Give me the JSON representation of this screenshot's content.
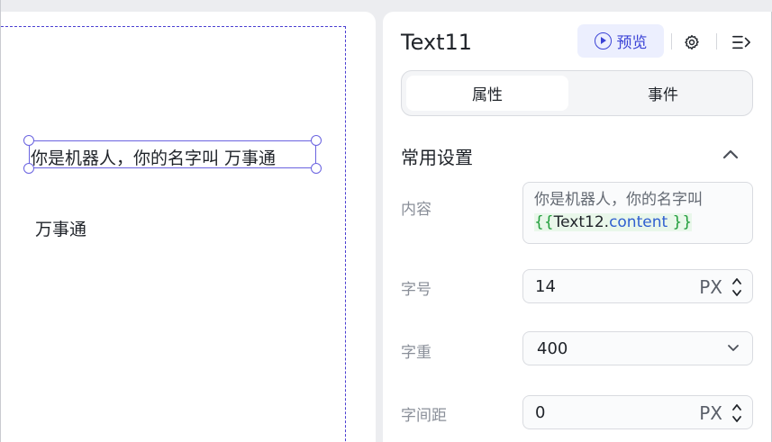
{
  "canvas": {
    "selected_text": "你是机器人，你的名字叫 万事通",
    "text12": "万事通"
  },
  "panel": {
    "title": "Text11",
    "preview_label": "预览",
    "tabs": [
      "属性",
      "事件"
    ],
    "section_title": "常用设置",
    "content": {
      "label": "内容",
      "text_prefix": "你是机器人，你的名字叫 ",
      "open_brace": "{{",
      "expr_object": "Text12.",
      "expr_prop": "content",
      "close_brace": " }}"
    },
    "font_size": {
      "label": "字号",
      "value": "14",
      "unit": "PX"
    },
    "font_weight": {
      "label": "字重",
      "value": "400"
    },
    "letter_spacing": {
      "label": "字间距",
      "value": "0",
      "unit": "PX"
    }
  },
  "colors": {
    "accent": "#3b43d6",
    "selection": "#6a63e0",
    "binding_bg": "#e9f7ea",
    "binding_brace": "#1f9d3a"
  },
  "icons": [
    "play-icon",
    "gear-icon",
    "collapse-panel-icon",
    "chevron-up-icon",
    "stepper-icon",
    "chevron-down-icon"
  ]
}
